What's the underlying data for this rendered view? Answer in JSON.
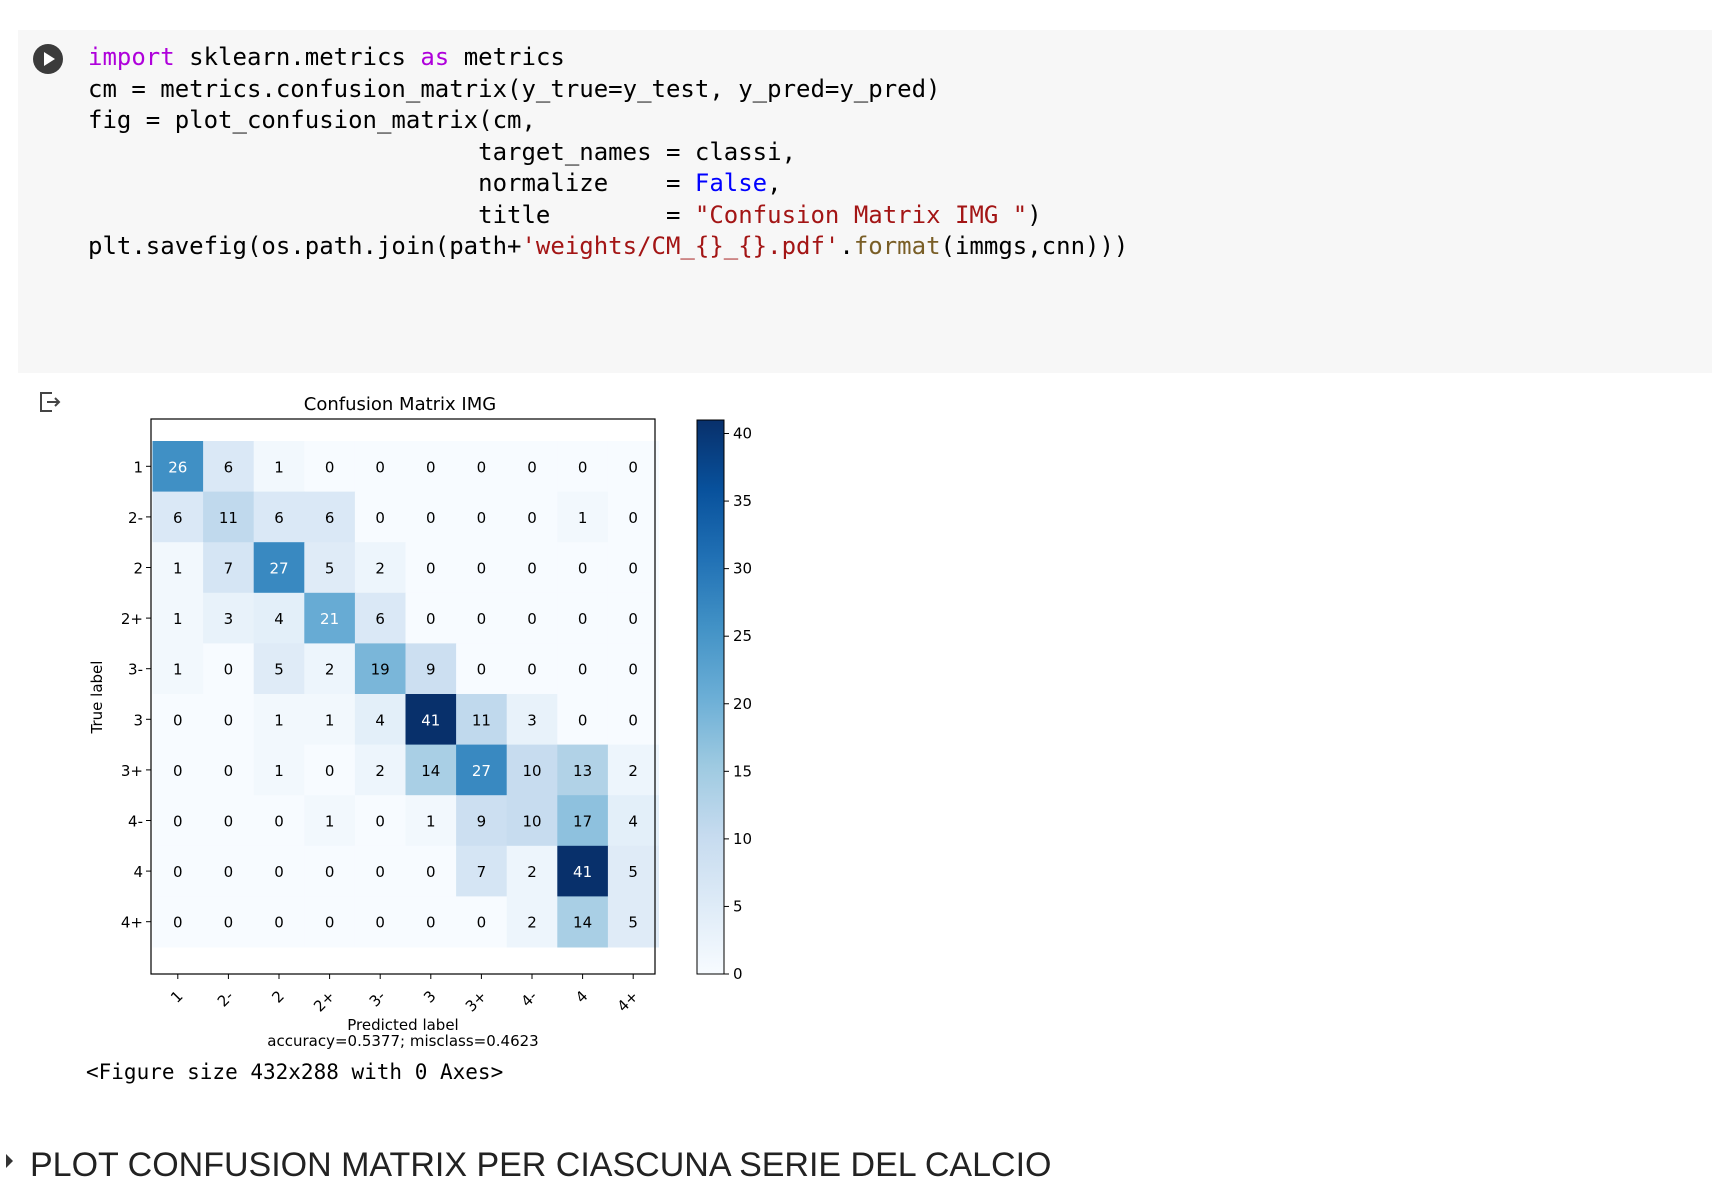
{
  "cell": {
    "code_lines": [
      [
        {
          "t": "import",
          "c": "kw"
        },
        {
          "t": " sklearn.metrics "
        },
        {
          "t": "as",
          "c": "kw"
        },
        {
          "t": " metrics"
        }
      ],
      [
        {
          "t": "cm = metrics.confusion_matrix(y_true=y_test, y_pred=y_pred)"
        }
      ],
      [
        {
          "t": "fig = plot_confusion_matrix(cm,"
        }
      ],
      [
        {
          "t": "                           target_names = classi,"
        }
      ],
      [
        {
          "t": "                           normalize    = "
        },
        {
          "t": "False",
          "c": "bool"
        },
        {
          "t": ","
        }
      ],
      [
        {
          "t": "                           title        = "
        },
        {
          "t": "\"Confusion Matrix IMG \"",
          "c": "str"
        },
        {
          "t": ")"
        }
      ],
      [
        {
          "t": "plt.savefig(os.path.join(path+"
        },
        {
          "t": "'weights/CM_{}_{}.pdf'",
          "c": "str"
        },
        {
          "t": "."
        },
        {
          "t": "format",
          "c": "fn"
        },
        {
          "t": "(immgs,cnn)))"
        }
      ]
    ]
  },
  "output": {
    "figure_text": "<Figure size 432x288 with 0 Axes>"
  },
  "section": {
    "title": "PLOT CONFUSION MATRIX PER CIASCUNA SERIE DEL CALCIO"
  },
  "colors": {
    "cmap_low": "#f7fbff",
    "cmap_high": "#08306b"
  },
  "chart_data": {
    "type": "heatmap",
    "title": "Confusion Matrix IMG",
    "xlabel": "Predicted label",
    "ylabel": "True label",
    "footer": "accuracy=0.5377; misclass=0.4623",
    "labels": [
      "1",
      "2-",
      "2",
      "2+",
      "3-",
      "3",
      "3+",
      "4-",
      "4",
      "4+"
    ],
    "matrix": [
      [
        26,
        6,
        1,
        0,
        0,
        0,
        0,
        0,
        0,
        0
      ],
      [
        6,
        11,
        6,
        6,
        0,
        0,
        0,
        0,
        1,
        0
      ],
      [
        1,
        7,
        27,
        5,
        2,
        0,
        0,
        0,
        0,
        0
      ],
      [
        1,
        3,
        4,
        21,
        6,
        0,
        0,
        0,
        0,
        0
      ],
      [
        1,
        0,
        5,
        2,
        19,
        9,
        0,
        0,
        0,
        0
      ],
      [
        0,
        0,
        1,
        1,
        4,
        41,
        11,
        3,
        0,
        0
      ],
      [
        0,
        0,
        1,
        0,
        2,
        14,
        27,
        10,
        13,
        2
      ],
      [
        0,
        0,
        0,
        1,
        0,
        1,
        9,
        10,
        17,
        4
      ],
      [
        0,
        0,
        0,
        0,
        0,
        0,
        7,
        2,
        41,
        5
      ],
      [
        0,
        0,
        0,
        0,
        0,
        0,
        0,
        2,
        14,
        5
      ]
    ],
    "colorbar": {
      "min": 0,
      "max": 41,
      "ticks": [
        0,
        5,
        10,
        15,
        20,
        25,
        30,
        35,
        40
      ]
    },
    "grid": false
  }
}
